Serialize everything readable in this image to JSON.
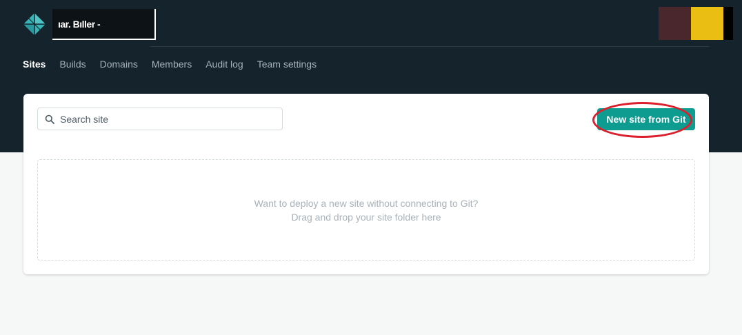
{
  "header": {
    "team_name": "ıar. Bıller -",
    "avatar_colors": [
      "#4a272c",
      "#ebbe13",
      "#000000"
    ],
    "logo_icon": "netlify-logo-icon"
  },
  "nav": {
    "tabs": [
      {
        "label": "Sites",
        "active": true
      },
      {
        "label": "Builds",
        "active": false
      },
      {
        "label": "Domains",
        "active": false
      },
      {
        "label": "Members",
        "active": false
      },
      {
        "label": "Audit log",
        "active": false
      },
      {
        "label": "Team settings",
        "active": false
      }
    ]
  },
  "search": {
    "placeholder": "Search site",
    "value": "",
    "icon": "search-icon"
  },
  "actions": {
    "new_site_label": "New site from Git"
  },
  "dropzone": {
    "line1": "Want to deploy a new site without connecting to Git?",
    "line2": "Drag and drop your site folder here"
  },
  "colors": {
    "header_bg": "#15232c",
    "accent": "#0e9b90",
    "highlight": "#dc1f2d"
  }
}
